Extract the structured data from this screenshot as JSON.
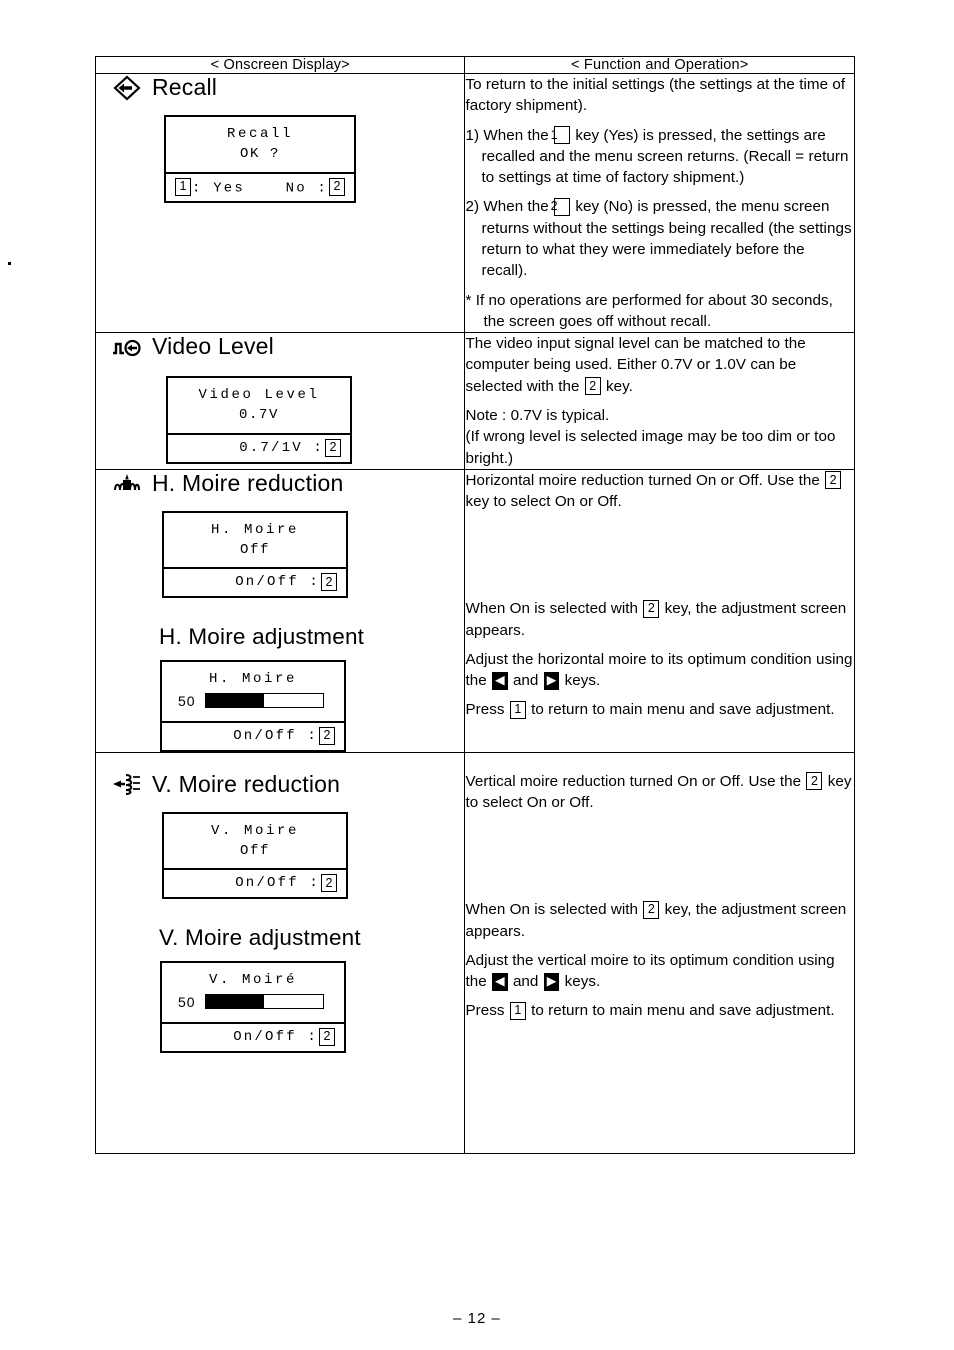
{
  "page": {
    "number_label": "– 12 –"
  },
  "table": {
    "headers": {
      "onscreen_display": "< Onscreen Display>",
      "function_and_operation": "< Function and Operation>"
    }
  },
  "sections": [
    {
      "id": "recall",
      "icon": "recall-diamond-arrow-icon",
      "title": "Recall",
      "osd": {
        "title_line": "Recall",
        "second_line": "OK ?",
        "bottom_left_key": "1",
        "bottom_left_text": ": Yes",
        "bottom_right_text": "No :",
        "bottom_right_key": "2"
      },
      "function_paragraphs": [
        "To return to the initial settings (the settings at the time of factory shipment).",
        "1) When the [1] key (Yes) is pressed, the settings are recalled and the menu screen returns. (Recall = return to settings at time of factory shipment.)",
        "2) When the [2] key (No) is pressed, the menu screen returns without the settings being recalled (the settings return to what they were immediately before the recall).",
        "*  If no operations are performed for about 30 seconds, the screen goes off without recall."
      ]
    },
    {
      "id": "video-level",
      "icon": "video-level-waveform-icon",
      "title": "Video Level",
      "osd": {
        "title_line": "Video Level",
        "second_line": "0.7V",
        "bottom_right_text": "0.7/1V :",
        "bottom_right_key": "2"
      },
      "function_paragraphs": [
        "The video input signal level can be matched to the computer being used. Either 0.7V or 1.0V can be selected with the [2] key.",
        "Note : 0.7V is typical.",
        "(If wrong level is selected image may be too dim or too bright.)"
      ]
    },
    {
      "id": "h-moire-reduction",
      "icon": "h-moire-pattern-icon",
      "title": "H. Moire reduction",
      "osd": {
        "title_line": "H. Moire",
        "second_line": "Off",
        "bottom_right_text": "On/Off :",
        "bottom_right_key": "2"
      },
      "function_paragraphs": [
        "Horizontal moire reduction turned On or Off.",
        "Use the [2] key to select On or Off."
      ]
    },
    {
      "id": "h-moire-adjustment",
      "title": "H. Moire adjustment",
      "osd": {
        "title_line": "H. Moire",
        "slider_value": "50",
        "slider_percent": 50,
        "bottom_right_text": "On/Off :",
        "bottom_right_key": "2"
      },
      "function_paragraphs": [
        "When On is selected with [2] key, the adjustment screen appears.",
        "Adjust the horizontal moire to its optimum condition using the [<] and [>] keys.",
        "Press [1] to return to main menu and save adjustment."
      ]
    },
    {
      "id": "v-moire-reduction",
      "icon": "v-moire-pattern-icon",
      "title": "V. Moire reduction",
      "osd": {
        "title_line": "V. Moire",
        "second_line": "Off",
        "bottom_right_text": "On/Off :",
        "bottom_right_key": "2"
      },
      "function_paragraphs": [
        "Vertical moire reduction turned On or Off.",
        "Use the [2] key to select On or Off."
      ]
    },
    {
      "id": "v-moire-adjustment",
      "title": "V. Moire adjustment",
      "osd": {
        "title_line": "V. Moiré",
        "slider_value": "50",
        "slider_percent": 50,
        "bottom_right_text": "On/Off :",
        "bottom_right_key": "2"
      },
      "function_paragraphs": [
        "When On is selected with [2] key, the adjustment screen appears.",
        "Adjust the vertical moire to its optimum condition using the [<] and [>] keys.",
        "Press [1] to return to main menu and save adjustment."
      ]
    }
  ],
  "text_fragments": {
    "recall": {
      "p1a": "To return to the initial settings (the settings at the",
      "p1b": "time of factory shipment).",
      "p2_pre": "1) When the",
      "p2_key": "1",
      "p2_post": "key (Yes) is pressed, the settings",
      "p2_l2": "are recalled and the menu screen returns.",
      "p2_l3": "(Recall = return to settings at time of factory",
      "p2_l4": "shipment.)",
      "p3_pre": "2) When the",
      "p3_key": "2",
      "p3_post": "key (No) is pressed, the menu",
      "p3_l2": "screen returns without the settings being",
      "p3_l3": "recalled (the settings return to what they were",
      "p3_l4": "immediately before the recall).",
      "p4_star": "*",
      "p4_l1": "If no operations are performed for about 30",
      "p4_l2": "seconds, the screen goes off without recall."
    },
    "video_level": {
      "l1": "The video input signal level can be matched to",
      "l2": "the computer being used. Either 0.7V or 1.0V",
      "l3_pre": "can be selected with the",
      "l3_key": "2",
      "l3_post": "key.",
      "note": "Note : 0.7V is typical.",
      "l4": "(If wrong level is selected image may be too dim",
      "l5": "or too bright.)"
    },
    "h_moire_red": {
      "l1": "Horizontal moire reduction turned On or Off.",
      "l2_pre": "Use the",
      "l2_key": "2",
      "l2_post": "key to select On or Off."
    },
    "h_moire_adj": {
      "l1_pre": "When On is selected with",
      "l1_key": "2",
      "l1_post": "key, the adjustment",
      "l2": "screen appears.",
      "l3": "Adjust the horizontal moire to its optimum",
      "l4_pre": "condition using the",
      "l4_left": "◀",
      "l4_mid": "and",
      "l4_right": "▶",
      "l4_post": "keys.",
      "l5_pre": "Press",
      "l5_key": "1",
      "l5_post": "to return to main menu and save",
      "l6": "adjustment."
    },
    "v_moire_red": {
      "l1": "Vertical moire reduction turned On or Off.",
      "l2_pre": "Use the",
      "l2_key": "2",
      "l2_post": "key to select On or Off."
    },
    "v_moire_adj": {
      "l1_pre": "When On is selected with",
      "l1_key": "2",
      "l1_post": "key, the adjustment",
      "l2": "screen appears.",
      "l3": "Adjust the vertical moire to its optimum",
      "l4_pre": "condition using the",
      "l4_left": "◀",
      "l4_mid": "and",
      "l4_right": "▶",
      "l4_post": "keys.",
      "l5_pre": "Press",
      "l5_key": "1",
      "l5_post": "to return to main menu and save",
      "l6": "adjustment."
    }
  }
}
